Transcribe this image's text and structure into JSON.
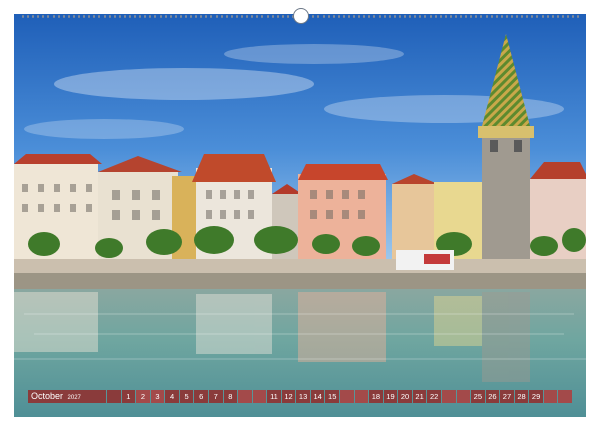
{
  "calendar": {
    "month": "October",
    "year": "2027",
    "days": [
      {
        "label": "",
        "weekend": false
      },
      {
        "label": "1",
        "weekend": false
      },
      {
        "label": "2",
        "weekend": true
      },
      {
        "label": "3",
        "weekend": true
      },
      {
        "label": "4",
        "weekend": false
      },
      {
        "label": "5",
        "weekend": false
      },
      {
        "label": "6",
        "weekend": false
      },
      {
        "label": "7",
        "weekend": false
      },
      {
        "label": "8",
        "weekend": false
      },
      {
        "label": "",
        "weekend": true
      },
      {
        "label": "",
        "weekend": true
      },
      {
        "label": "11",
        "weekend": false
      },
      {
        "label": "12",
        "weekend": false
      },
      {
        "label": "13",
        "weekend": false
      },
      {
        "label": "14",
        "weekend": false
      },
      {
        "label": "15",
        "weekend": false
      },
      {
        "label": "",
        "weekend": true
      },
      {
        "label": "",
        "weekend": true
      },
      {
        "label": "18",
        "weekend": false
      },
      {
        "label": "19",
        "weekend": false
      },
      {
        "label": "20",
        "weekend": false
      },
      {
        "label": "21",
        "weekend": false
      },
      {
        "label": "22",
        "weekend": false
      },
      {
        "label": "",
        "weekend": true
      },
      {
        "label": "",
        "weekend": true
      },
      {
        "label": "25",
        "weekend": false
      },
      {
        "label": "26",
        "weekend": false
      },
      {
        "label": "27",
        "weekend": false
      },
      {
        "label": "28",
        "weekend": false
      },
      {
        "label": "29",
        "weekend": false
      },
      {
        "label": "",
        "weekend": true
      },
      {
        "label": "",
        "weekend": true
      }
    ]
  },
  "photo": {
    "subject": "harbour-promenade-with-tower",
    "colors": {
      "sky_top": "#1f5fb8",
      "sky_bottom": "#7fb5e6",
      "water": "#6fa6a0",
      "strip": "#8a3b3b"
    }
  }
}
